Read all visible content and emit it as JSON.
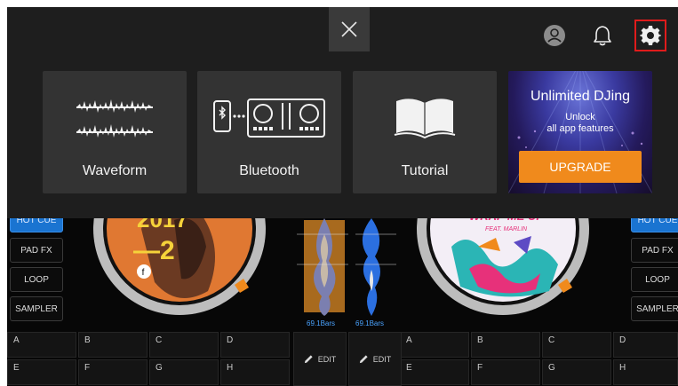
{
  "overlay": {
    "cards": [
      {
        "label": "Waveform",
        "icon": "waveform-icon"
      },
      {
        "label": "Bluetooth",
        "icon": "bluetooth-controller-icon"
      },
      {
        "label": "Tutorial",
        "icon": "book-icon"
      }
    ],
    "promo": {
      "title": "Unlimited DJing",
      "subtitle_line1": "Unlock",
      "subtitle_line2": "all app features",
      "button": "UPGRADE"
    },
    "icons": {
      "close": "close-icon",
      "account": "account-icon",
      "bell": "bell-icon",
      "settings": "gear-icon"
    }
  },
  "deck": {
    "left_buttons": [
      "HOT CUE",
      "PAD FX",
      "LOOP",
      "SAMPLER"
    ],
    "right_buttons": [
      "HOT CUE",
      "PAD FX",
      "LOOP",
      "SAMPLER"
    ],
    "left_bars": "69.1Bars",
    "right_bars": "69.1Bars",
    "left_art_text": "—2",
    "left_art_year": "2017",
    "right_art_text": "WRAP ME UP",
    "right_art_feat": "FEAT. MARLIN",
    "left_pads_top": [
      "A",
      "B",
      "C",
      "D"
    ],
    "left_pads_bottom": [
      "E",
      "F",
      "G",
      "H"
    ],
    "right_pads_top": [
      "A",
      "B",
      "C",
      "D"
    ],
    "right_pads_bottom": [
      "E",
      "F",
      "G",
      "H"
    ],
    "edit_label": "EDIT"
  },
  "colors": {
    "accent_blue": "#1a74d1",
    "upgrade_orange": "#f08a1c",
    "highlight_red": "#e01b1b"
  }
}
